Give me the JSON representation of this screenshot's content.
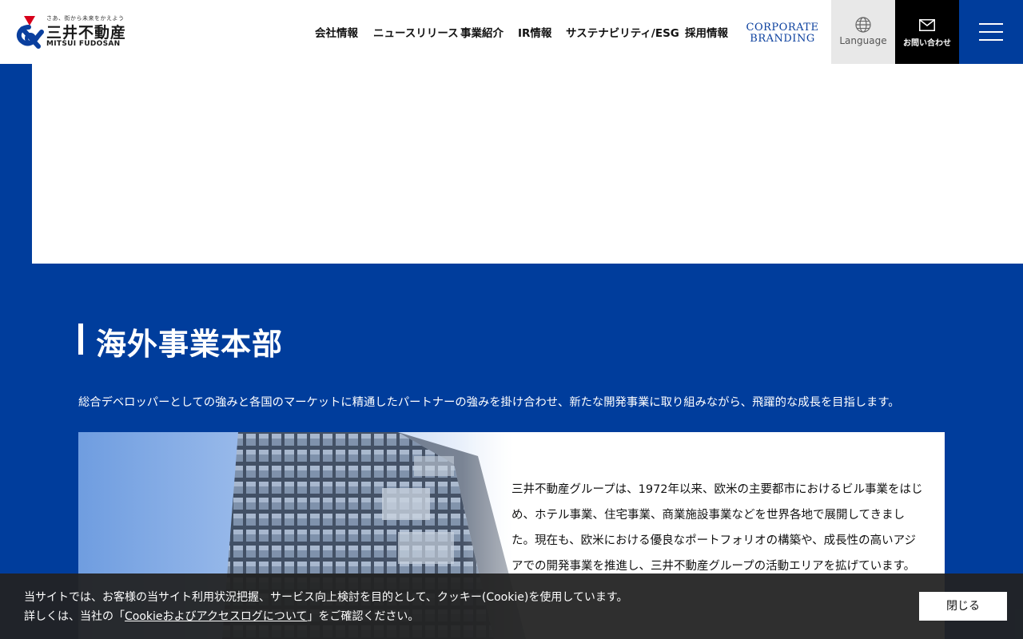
{
  "header": {
    "logo": {
      "tagline": "さあ、街から未来をかえよう",
      "name_ja": "三井不動産",
      "name_en": "MITSUI FUDOSAN"
    },
    "nav": [
      {
        "label": "会社情報"
      },
      {
        "label": "ニュースリリース"
      },
      {
        "label": "事業紹介"
      },
      {
        "label": "IR情報"
      },
      {
        "label": "サステナビリティ/ESG"
      },
      {
        "label": "採用情報"
      }
    ],
    "corporate_branding": {
      "line1": "CORPORATE",
      "line2": "BRANDING"
    },
    "language": {
      "label": "Language",
      "icon": "globe-icon"
    },
    "contact": {
      "label": "お問い合わせ",
      "icon": "mail-icon"
    },
    "menu": {
      "icon": "hamburger-menu-icon"
    }
  },
  "section": {
    "title": "海外事業本部",
    "lead": "総合デベロッパーとしての強みと各国のマーケットに精通したパートナーの強みを掛け合わせ、新たな開発事業に取り組みながら、飛躍的な成長を目指します。",
    "body": "三井不動産グループは、1972年以来、欧米の主要都市におけるビル事業をはじめ、ホテル事業、住宅事業、商業施設事業などを世界各地で展開してきました。現在も、欧米における優良なポートフォリオの構築や、成長性の高いアジアでの開発事業を推進し、三井不動産グループの活動エリアを拡げています。"
  },
  "cookie_banner": {
    "line1": "当サイトでは、お客様の当サイト利用状況把握、サービス向上検討を目的として、クッキー(Cookie)を使用しています。",
    "line2_prefix": "詳しくは、当社の「",
    "link": "Cookieおよびアクセスログについて",
    "line2_suffix": "」をご確認ください。",
    "close_label": "閉じる"
  },
  "colors": {
    "brand_blue": "#003d9c",
    "logo_red": "#d7001a",
    "banner_bg": "#222222"
  }
}
